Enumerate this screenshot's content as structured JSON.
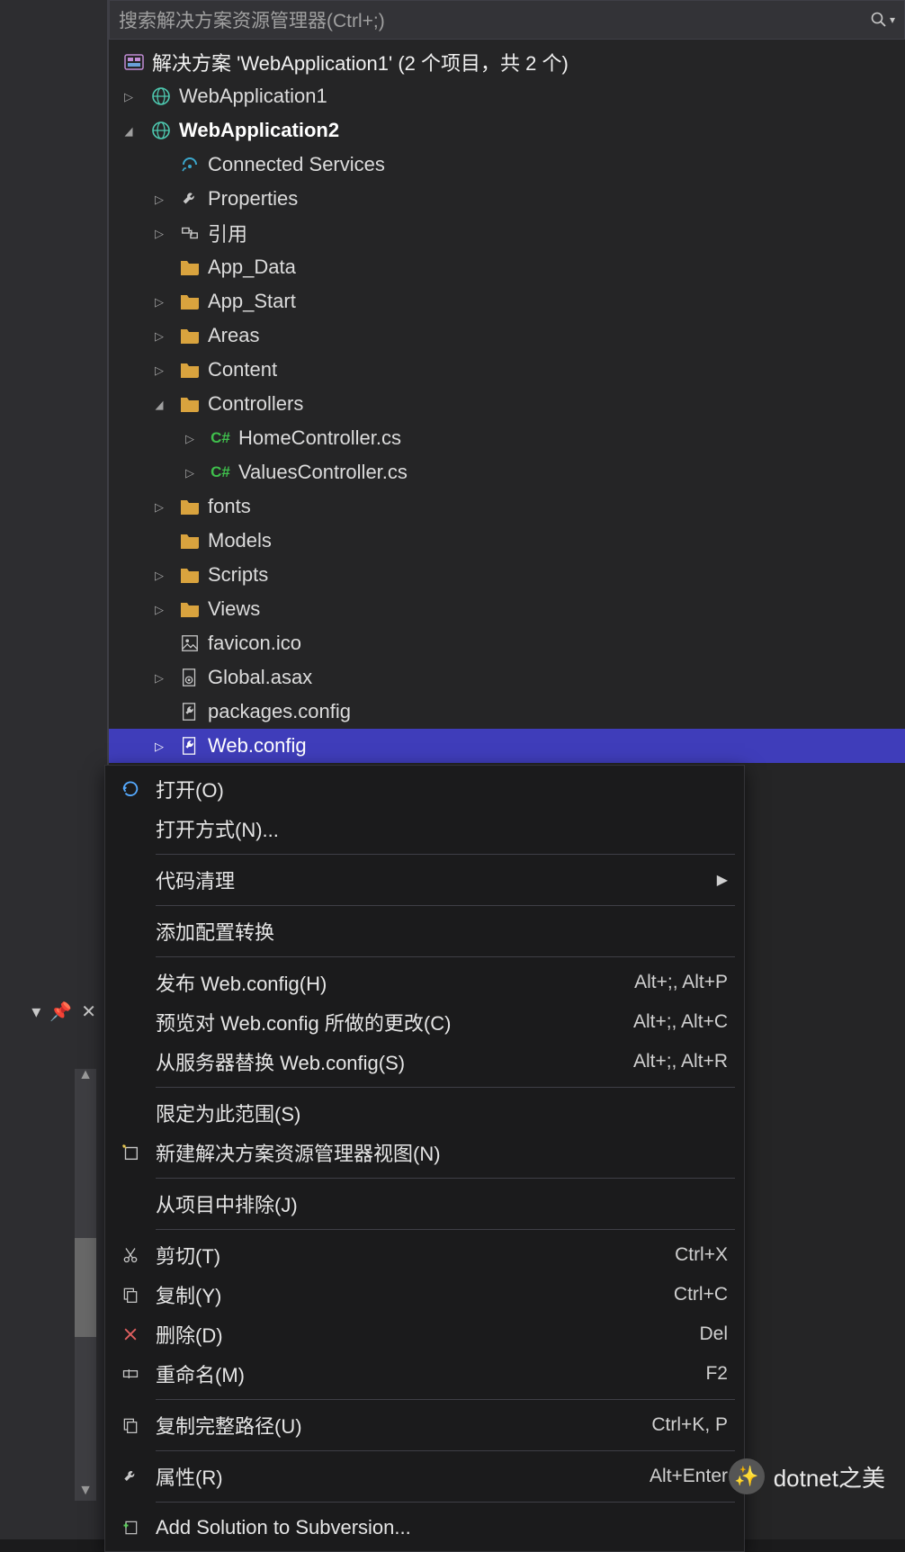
{
  "search": {
    "placeholder": "搜索解决方案资源管理器(Ctrl+;)"
  },
  "tree": {
    "solution": {
      "label": "解决方案 'WebApplication1' (2 个项目，共 2 个)"
    },
    "project1": {
      "label": "WebApplication1"
    },
    "project2": {
      "label": "WebApplication2"
    },
    "connected": {
      "label": "Connected Services"
    },
    "properties": {
      "label": "Properties"
    },
    "references": {
      "label": "引用"
    },
    "appdata": {
      "label": "App_Data"
    },
    "appstart": {
      "label": "App_Start"
    },
    "areas": {
      "label": "Areas"
    },
    "content": {
      "label": "Content"
    },
    "controllers": {
      "label": "Controllers"
    },
    "homectrl": {
      "label": "HomeController.cs",
      "lang": "C#"
    },
    "valuesctrl": {
      "label": "ValuesController.cs",
      "lang": "C#"
    },
    "fonts": {
      "label": "fonts"
    },
    "models": {
      "label": "Models"
    },
    "scripts": {
      "label": "Scripts"
    },
    "views": {
      "label": "Views"
    },
    "favicon": {
      "label": "favicon.ico"
    },
    "global": {
      "label": "Global.asax"
    },
    "packages": {
      "label": "packages.config"
    },
    "webconfig": {
      "label": "Web.config"
    }
  },
  "ctx": {
    "open": "打开(O)",
    "openwith": "打开方式(N)...",
    "codeclean": "代码清理",
    "addtransform": "添加配置转换",
    "publish": {
      "label": "发布 Web.config(H)",
      "key": "Alt+;, Alt+P"
    },
    "preview": {
      "label": "预览对 Web.config 所做的更改(C)",
      "key": "Alt+;, Alt+C"
    },
    "replace": {
      "label": "从服务器替换 Web.config(S)",
      "key": "Alt+;, Alt+R"
    },
    "scope": "限定为此范围(S)",
    "newview": "新建解决方案资源管理器视图(N)",
    "exclude": "从项目中排除(J)",
    "cut": {
      "label": "剪切(T)",
      "key": "Ctrl+X"
    },
    "copy": {
      "label": "复制(Y)",
      "key": "Ctrl+C"
    },
    "delete": {
      "label": "删除(D)",
      "key": "Del"
    },
    "rename": {
      "label": "重命名(M)",
      "key": "F2"
    },
    "copypath": {
      "label": "复制完整路径(U)",
      "key": "Ctrl+K, P"
    },
    "props": {
      "label": "属性(R)",
      "key": "Alt+Enter"
    },
    "svn": "Add Solution to Subversion..."
  },
  "watermark": "dotnet之美"
}
